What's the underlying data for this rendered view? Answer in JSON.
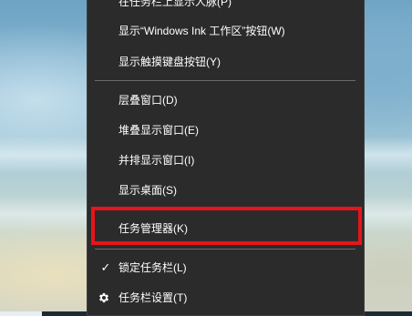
{
  "context_menu": {
    "items": [
      {
        "label": "在任务栏上显示人脉(P)"
      },
      {
        "label": "显示“Windows Ink 工作区”按钮(W)"
      },
      {
        "label": "显示触摸键盘按钮(Y)"
      },
      {
        "label": "层叠窗口(D)"
      },
      {
        "label": "堆叠显示窗口(E)"
      },
      {
        "label": "并排显示窗口(I)"
      },
      {
        "label": "显示桌面(S)"
      },
      {
        "label": "任务管理器(K)"
      },
      {
        "label": "锁定任务栏(L)",
        "checked": true
      },
      {
        "label": "任务栏设置(T)",
        "icon": "gear-icon"
      }
    ]
  },
  "highlight": {
    "target": "任务管理器(K)",
    "color": "#e8141b"
  },
  "colors": {
    "menu_background": "#2b2b2b",
    "menu_text": "#ffffff",
    "separator": "#6a6a6a"
  }
}
